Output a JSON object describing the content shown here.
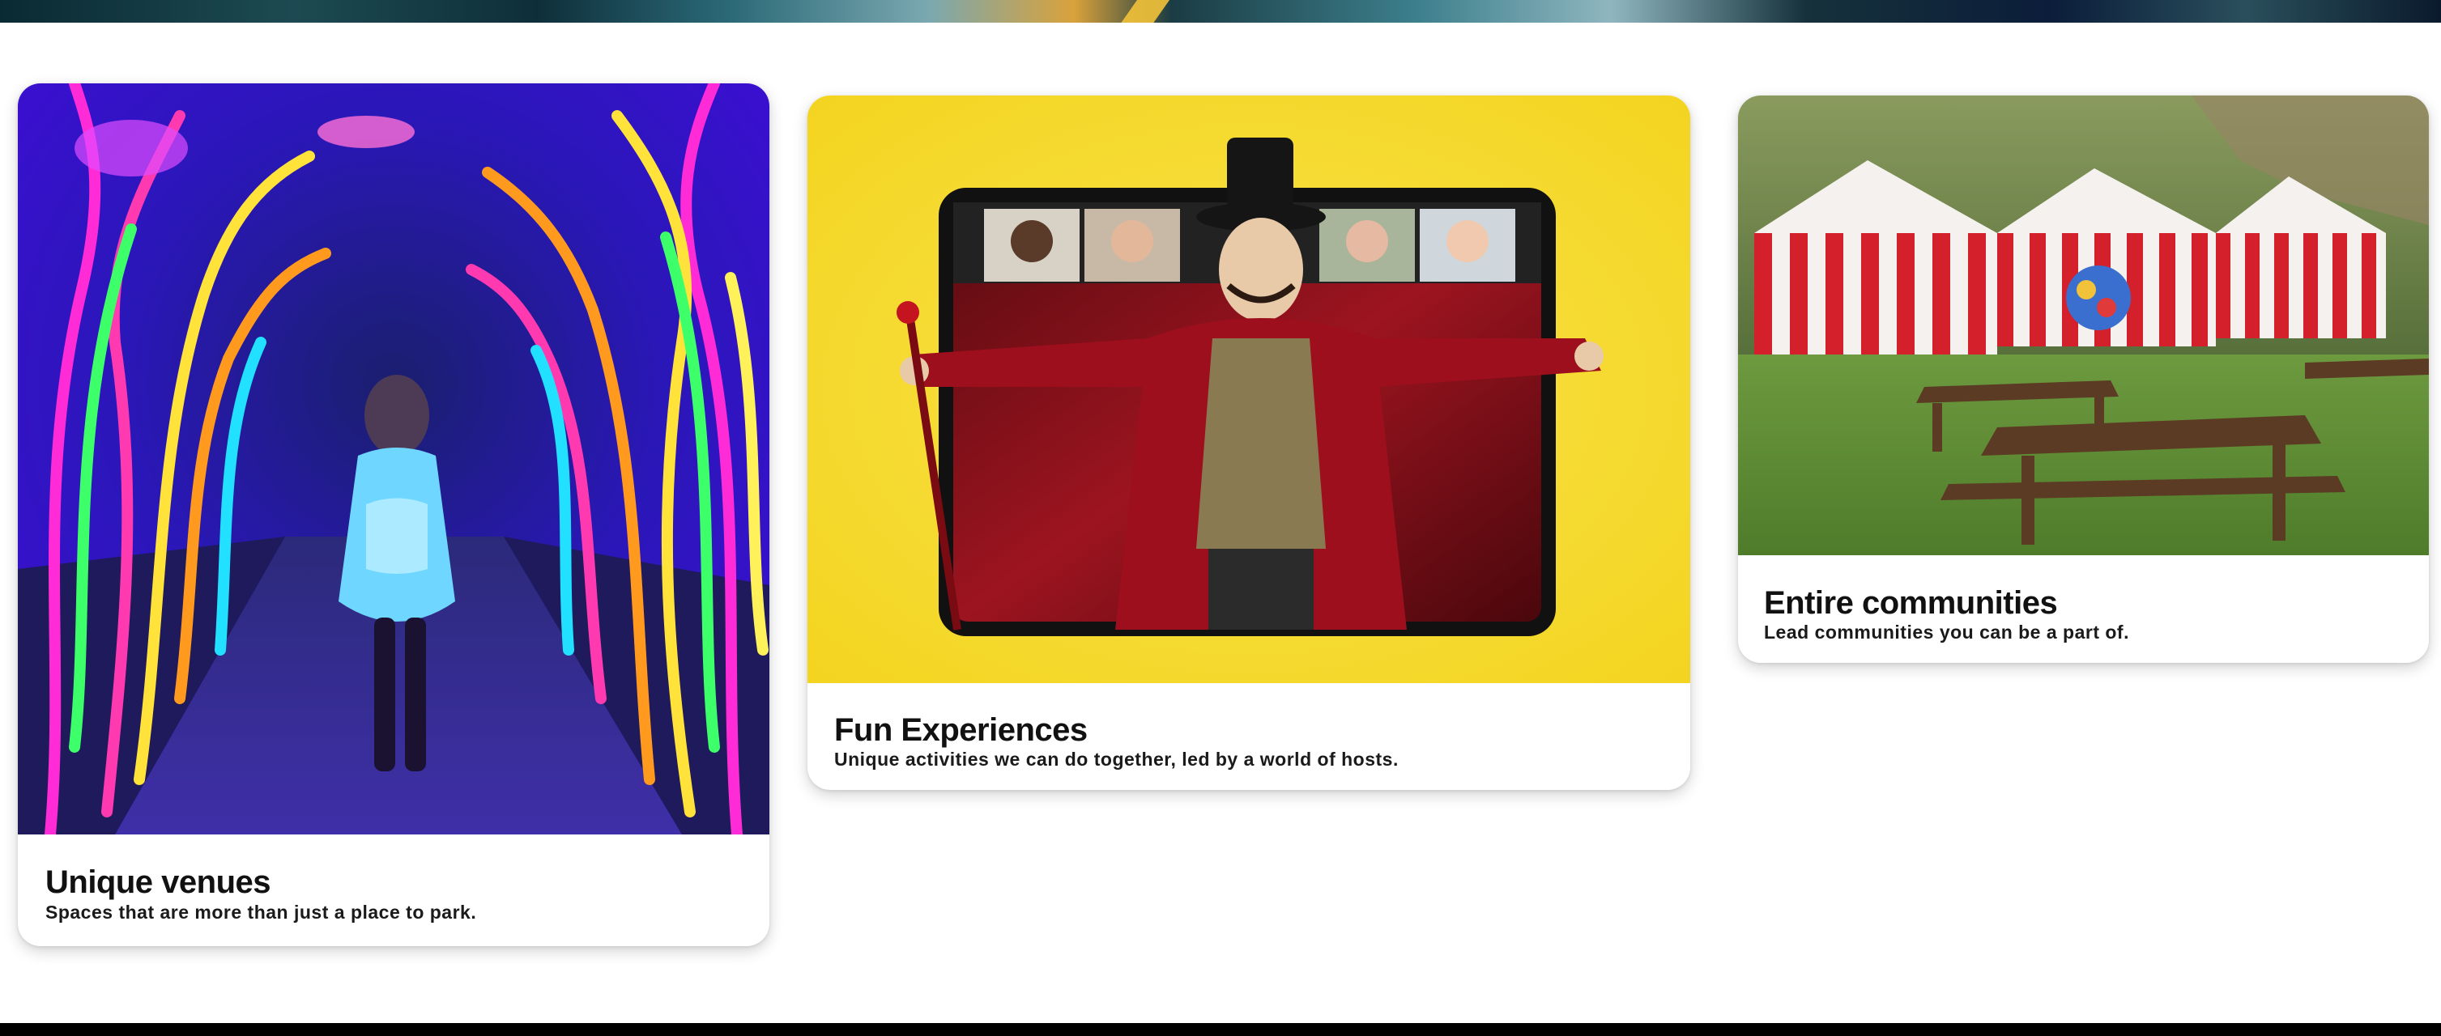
{
  "cards": [
    {
      "title": "Unique venues",
      "subtitle": "Spaces that are more than just a place to park.",
      "image": "neon-tree-tunnel-photo"
    },
    {
      "title": "Fun Experiences",
      "subtitle": "Unique activities we can do together, led by a world of hosts.",
      "image": "virtual-ringmaster-tablet-photo"
    },
    {
      "title": "Entire communities",
      "subtitle": "Lead communities you can be a part of.",
      "image": "carnival-tents-picnic-photo"
    }
  ],
  "colors": {
    "page_background": "#ffffff",
    "card_background": "#ffffff",
    "title_text": "#111111",
    "footer_bar": "#000000",
    "experiences_yellow": "#f6dc2e"
  }
}
